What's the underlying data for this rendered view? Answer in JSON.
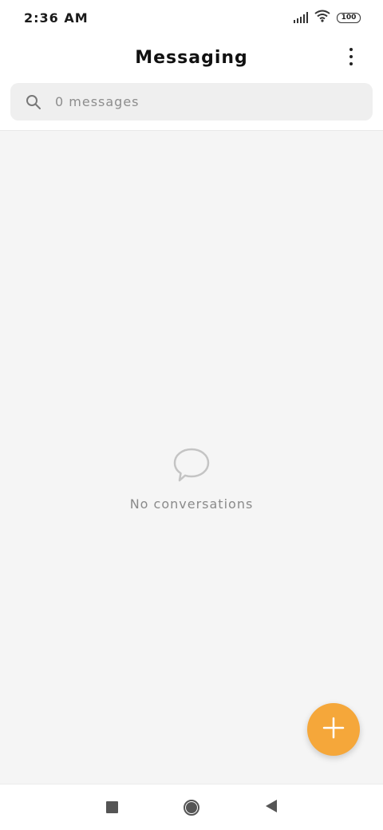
{
  "status_bar": {
    "time": "2:36 AM",
    "battery": "100",
    "icons": [
      "signal-icon",
      "wifi-icon",
      "battery-icon"
    ]
  },
  "header": {
    "title": "Messaging",
    "more_icon": "more-vert-icon"
  },
  "search": {
    "icon": "search-icon",
    "text": "0 messages"
  },
  "empty_state": {
    "icon": "chat-bubble-icon",
    "text": "No conversations"
  },
  "fab": {
    "icon": "plus-icon",
    "color": "#f5a73a"
  },
  "nav_bar": {
    "icons": [
      "recents-icon",
      "home-icon",
      "back-icon"
    ]
  },
  "colors": {
    "accent": "#f5a73a",
    "content_background": "#f5f5f5",
    "search_background": "#efefef"
  }
}
